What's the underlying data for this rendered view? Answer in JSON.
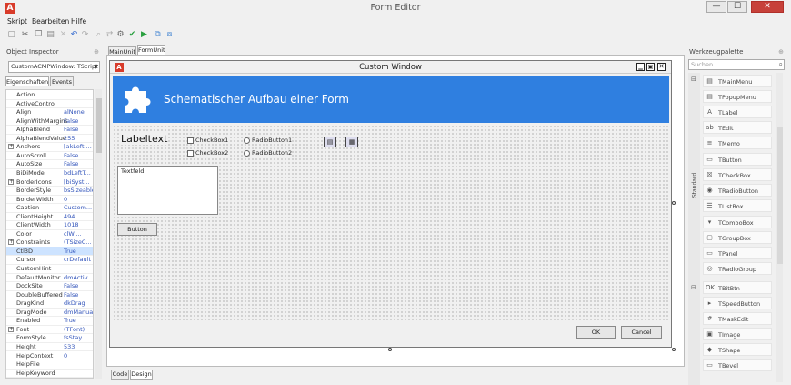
{
  "window": {
    "title": "Form Editor",
    "min": "—",
    "max": "☐",
    "close": "✕",
    "app_icon": "A"
  },
  "menu": [
    "Skript",
    "Bearbeiten",
    "Hilfe"
  ],
  "toolbar_icons": [
    "new-icon",
    "cut-icon",
    "copy-icon",
    "paste-icon",
    "delete-icon",
    "undo-icon",
    "redo-icon",
    "find-icon",
    "replace-icon",
    "settings-icon",
    "check-icon",
    "run-icon",
    "export-icon",
    "import-icon"
  ],
  "object_inspector": {
    "title": "Object Inspector",
    "selector": "CustomACMPWindow: TScript",
    "tabs": [
      "Eigenschaften",
      "Events"
    ],
    "rows": [
      {
        "name": "Action",
        "value": ""
      },
      {
        "name": "ActiveControl",
        "value": ""
      },
      {
        "name": "Align",
        "value": "alNone"
      },
      {
        "name": "AlignWithMargins",
        "value": "False"
      },
      {
        "name": "AlphaBlend",
        "value": "False"
      },
      {
        "name": "AlphaBlendValue",
        "value": "255"
      },
      {
        "name": "Anchors",
        "value": "[akLeft,...",
        "exp": "+"
      },
      {
        "name": "AutoScroll",
        "value": "False"
      },
      {
        "name": "AutoSize",
        "value": "False"
      },
      {
        "name": "BiDiMode",
        "value": "bdLeftT..."
      },
      {
        "name": "BorderIcons",
        "value": "[biSyst...",
        "exp": "+"
      },
      {
        "name": "BorderStyle",
        "value": "bsSizeable"
      },
      {
        "name": "BorderWidth",
        "value": "0"
      },
      {
        "name": "Caption",
        "value": "Custom..."
      },
      {
        "name": "ClientHeight",
        "value": "494"
      },
      {
        "name": "ClientWidth",
        "value": "1018"
      },
      {
        "name": "Color",
        "value": "clWi..."
      },
      {
        "name": "Constraints",
        "value": "(TSizeC...",
        "exp": "+"
      },
      {
        "name": "Ctl3D",
        "value": "True",
        "selected": true
      },
      {
        "name": "Cursor",
        "value": "crDefault"
      },
      {
        "name": "CustomHint",
        "value": ""
      },
      {
        "name": "DefaultMonitor",
        "value": "dmActiv..."
      },
      {
        "name": "DockSite",
        "value": "False"
      },
      {
        "name": "DoubleBuffered",
        "value": "False"
      },
      {
        "name": "DragKind",
        "value": "dkDrag"
      },
      {
        "name": "DragMode",
        "value": "dmManual"
      },
      {
        "name": "Enabled",
        "value": "True"
      },
      {
        "name": "Font",
        "value": "(TFont)",
        "exp": "+"
      },
      {
        "name": "FormStyle",
        "value": "fsStay..."
      },
      {
        "name": "Height",
        "value": "533"
      },
      {
        "name": "HelpContext",
        "value": "0"
      },
      {
        "name": "HelpFile",
        "value": ""
      },
      {
        "name": "HelpKeyword",
        "value": ""
      }
    ]
  },
  "editor_tabs": [
    "MainUnit",
    "FormUnit"
  ],
  "bottom_tabs": [
    "Code",
    "Design"
  ],
  "form": {
    "title": "Custom Window",
    "icon": "A",
    "banner_title": "Schematischer Aufbau einer Form",
    "label": "Labeltext",
    "checkbox1": "CheckBox1",
    "checkbox2": "CheckBox2",
    "radio1": "RadioButton1",
    "radio2": "RadioButton2",
    "memo": "Textfeld",
    "button": "Button",
    "ok": "OK",
    "cancel": "Cancel"
  },
  "palette": {
    "title": "Werkzeugpalette",
    "search_placeholder": "Suchen",
    "group": "Standard",
    "items": [
      {
        "label": "TMainMenu",
        "icon": "▤"
      },
      {
        "label": "TPopupMenu",
        "icon": "▤"
      },
      {
        "label": "TLabel",
        "icon": "A"
      },
      {
        "label": "TEdit",
        "icon": "ab"
      },
      {
        "label": "TMemo",
        "icon": "≡"
      },
      {
        "label": "TButton",
        "icon": "▭"
      },
      {
        "label": "TCheckBox",
        "icon": "☒"
      },
      {
        "label": "TRadioButton",
        "icon": "◉"
      },
      {
        "label": "TListBox",
        "icon": "☰"
      },
      {
        "label": "TComboBox",
        "icon": "▾"
      },
      {
        "label": "TGroupBox",
        "icon": "▢"
      },
      {
        "label": "TPanel",
        "icon": "▭"
      },
      {
        "label": "TRadioGroup",
        "icon": "◎"
      },
      {
        "label": "TBitBtn",
        "icon": "OK"
      },
      {
        "label": "TSpeedButton",
        "icon": "▸"
      },
      {
        "label": "TMaskEdit",
        "icon": "#"
      },
      {
        "label": "TImage",
        "icon": "▣"
      },
      {
        "label": "TShape",
        "icon": "◆"
      },
      {
        "label": "TBevel",
        "icon": "▭"
      }
    ]
  },
  "colors": {
    "banner": "#2f7fe0",
    "accent": "#d83b2a"
  }
}
